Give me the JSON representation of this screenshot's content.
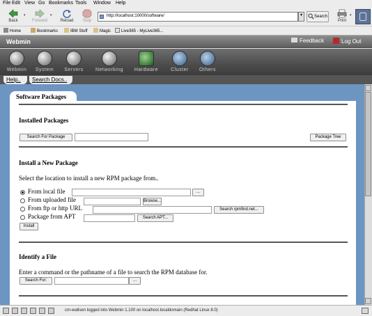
{
  "menus": [
    "File",
    "Edit",
    "View",
    "Go",
    "Bookmarks",
    "Tools",
    "Window",
    "Help"
  ],
  "nav": {
    "back": "Back",
    "forward": "Forward",
    "reload": "Reload",
    "stop": "Stop",
    "print": "Print",
    "url": "http://localhost:10000/software/",
    "search": "Search"
  },
  "bookmarks": [
    "Home",
    "Bookmarks",
    "IBM Stuff",
    "Magic",
    "Live365 - MyLive365..."
  ],
  "header": {
    "logo": "Webmin",
    "feedback": "Feedback",
    "logout": "Log Out"
  },
  "categories": [
    "Webmin",
    "System",
    "Servers",
    "Networking",
    "Hardware",
    "Cluster",
    "Others"
  ],
  "tabs": [
    "Help..",
    "Search Docs.."
  ],
  "page": {
    "title": "Software Packages",
    "installed": {
      "heading": "Installed Packages",
      "search_button": "Search For Package",
      "tree_button": "Package Tree"
    },
    "install": {
      "heading": "Install a New Package",
      "description": "Select the location to install a new RPM package from..",
      "options": [
        "From local file",
        "From uploaded file",
        "From ftp or http URL",
        "Package from APT"
      ],
      "selected": 0,
      "local_browse": "...",
      "upload_browse": "Browse...",
      "url_search": "Search rpmfind.net...",
      "apt_search": "Search APT...",
      "install_button": "Install"
    },
    "identify": {
      "heading": "Identify a File",
      "description": "Enter a command or the pathname of a file to search the RPM database for.",
      "search_button": "Search For:",
      "browse": "..."
    }
  },
  "status": {
    "text": "cm-wallsen logged into Webmin 1.100 on localhost.localdomain (Redhat Linux 8.0)"
  }
}
